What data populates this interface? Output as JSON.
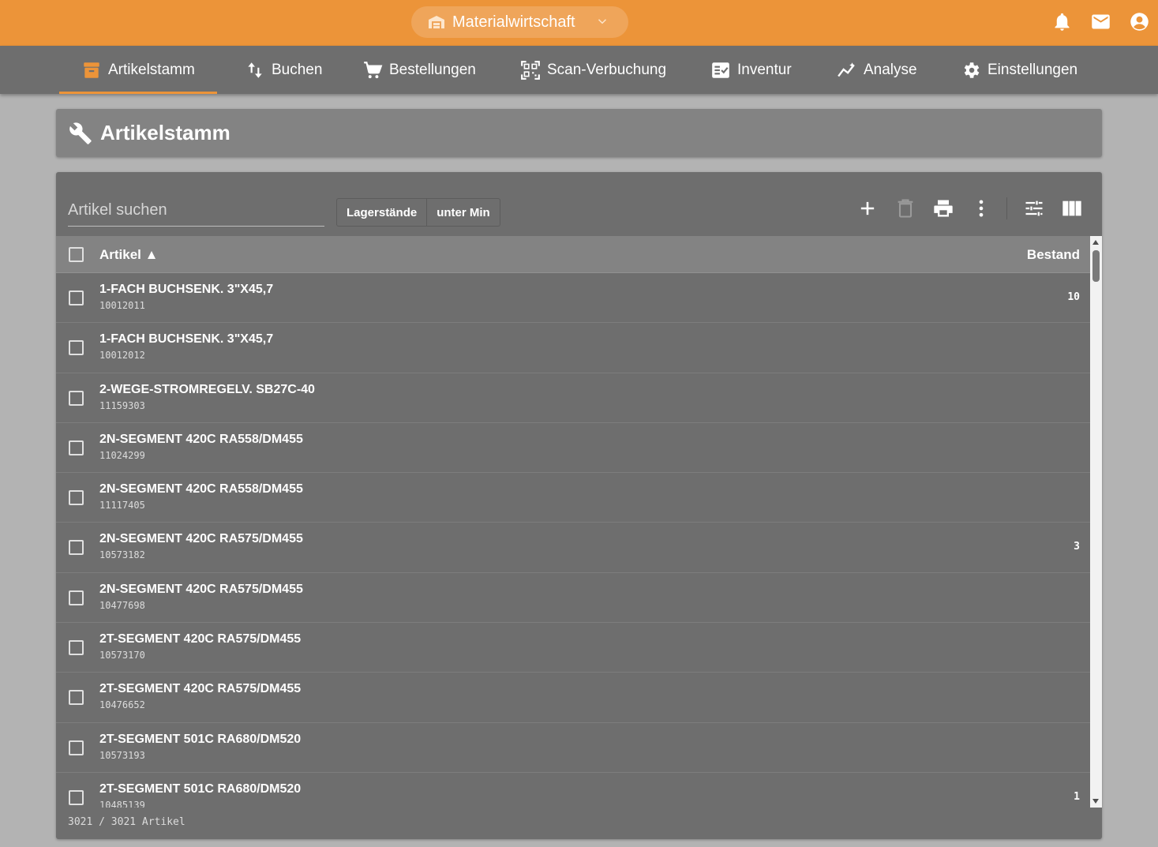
{
  "app": {
    "title": "Materialwirtschaft",
    "accent_color": "#ec9439"
  },
  "top_icons": [
    "bell-icon",
    "mail-icon",
    "account-icon"
  ],
  "nav": {
    "items": [
      {
        "label": "Artikelstamm",
        "icon": "archive-icon",
        "active": true
      },
      {
        "label": "Buchen",
        "icon": "swap-vertical-icon",
        "active": false
      },
      {
        "label": "Bestellungen",
        "icon": "cart-icon",
        "active": false
      },
      {
        "label": "Scan-Verbuchung",
        "icon": "qr-scan-icon",
        "active": false
      },
      {
        "label": "Inventur",
        "icon": "checklist-icon",
        "active": false
      },
      {
        "label": "Analyse",
        "icon": "chart-line-icon",
        "active": false
      },
      {
        "label": "Einstellungen",
        "icon": "gear-icon",
        "active": false
      }
    ]
  },
  "page": {
    "title": "Artikelstamm",
    "icon": "wrench-icon"
  },
  "toolbar": {
    "search_placeholder": "Artikel suchen",
    "filter_stock": "Lagerstände",
    "filter_min": "unter Min",
    "actions": [
      "add-icon",
      "delete-icon",
      "print-icon",
      "more-vert-icon",
      "filter-settings-icon",
      "columns-icon"
    ]
  },
  "table": {
    "col_article": "Artikel ▲",
    "col_stock": "Bestand",
    "rows": [
      {
        "name": "1-FACH BUCHSENK. 3\"X45,7",
        "code": "10012011",
        "stock": "10"
      },
      {
        "name": "1-FACH BUCHSENK. 3\"X45,7",
        "code": "10012012",
        "stock": ""
      },
      {
        "name": "2-WEGE-STROMREGELV. SB27C-40",
        "code": "11159303",
        "stock": ""
      },
      {
        "name": "2N-SEGMENT 420C RA558/DM455",
        "code": "11024299",
        "stock": ""
      },
      {
        "name": "2N-SEGMENT 420C RA558/DM455",
        "code": "11117405",
        "stock": ""
      },
      {
        "name": "2N-SEGMENT 420C RA575/DM455",
        "code": "10573182",
        "stock": "3"
      },
      {
        "name": "2N-SEGMENT 420C RA575/DM455",
        "code": "10477698",
        "stock": ""
      },
      {
        "name": "2T-SEGMENT 420C RA575/DM455",
        "code": "10573170",
        "stock": ""
      },
      {
        "name": "2T-SEGMENT 420C RA575/DM455",
        "code": "10476652",
        "stock": ""
      },
      {
        "name": "2T-SEGMENT 501C RA680/DM520",
        "code": "10573193",
        "stock": ""
      },
      {
        "name": "2T-SEGMENT 501C RA680/DM520",
        "code": "10485139",
        "stock": "1"
      }
    ]
  },
  "footer": {
    "count": "3021 / 3021 Artikel"
  }
}
